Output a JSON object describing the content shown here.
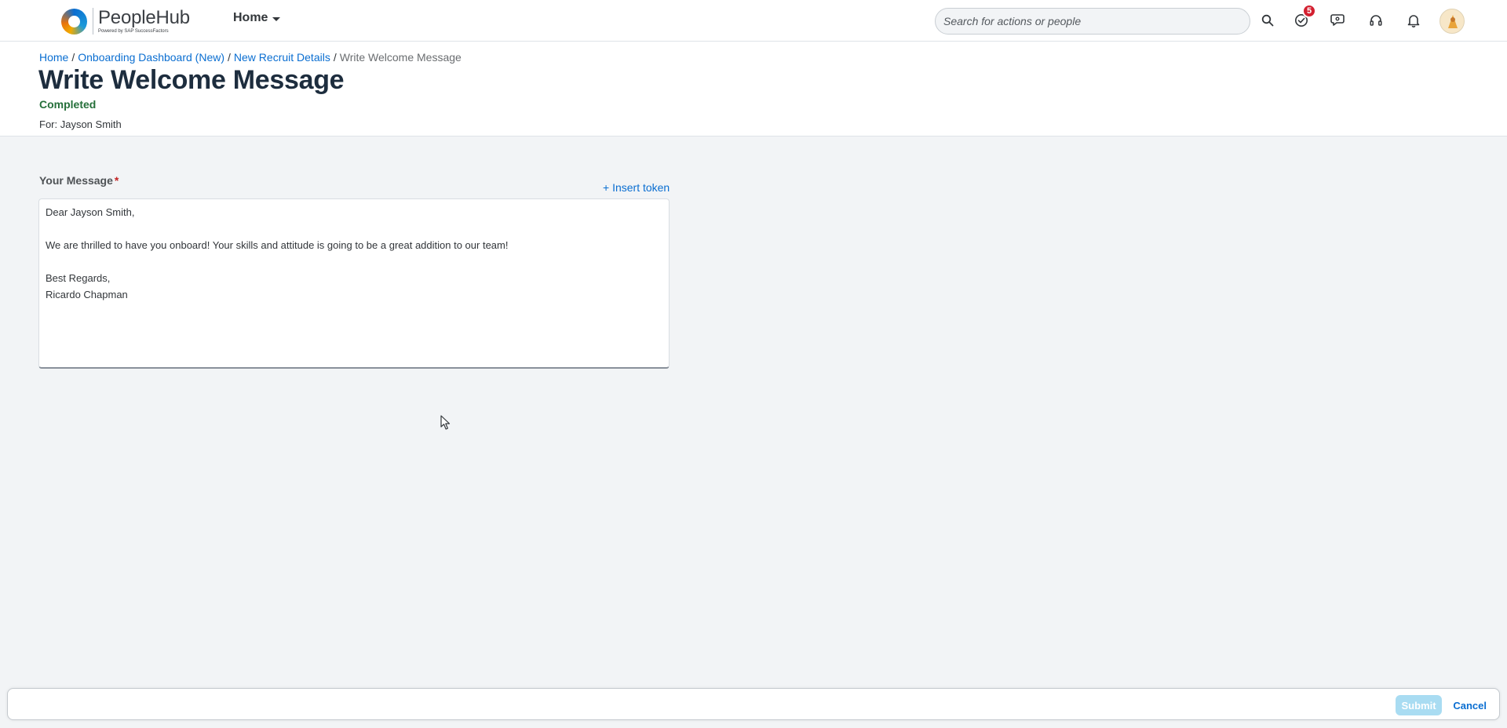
{
  "shell": {
    "logo_name": "PeopleHub",
    "logo_powered": "Powered by SAP SuccessFactors",
    "home_menu_label": "Home",
    "search_placeholder": "Search for actions or people",
    "todo_badge_count": "5",
    "icons": {
      "search": "search-icon",
      "todo": "checkmark-circle-icon",
      "chat": "chat-icon",
      "help": "headset-icon",
      "notifications": "bell-icon"
    }
  },
  "header": {
    "breadcrumb": {
      "items": [
        "Home",
        "Onboarding Dashboard (New)",
        "New Recruit Details"
      ],
      "current": "Write Welcome Message",
      "separator": "/"
    },
    "title": "Write Welcome Message",
    "status": "Completed",
    "status_color": "#256f3a",
    "for_line": "For: Jayson Smith"
  },
  "form": {
    "message_label": "Your Message",
    "required_marker": "*",
    "insert_token_label": "+ Insert token",
    "message_value": "Dear Jayson Smith,\n\nWe are thrilled to have you onboard! Your skills and attitude is going to be a great addition to our team!\n\nBest Regards,\nRicardo Chapman"
  },
  "footer": {
    "submit_label": "Submit",
    "cancel_label": "Cancel"
  },
  "colors": {
    "accent": "#0a6ed1",
    "title": "#1d2d3e",
    "badge": "#d32030",
    "submit_disabled": "#a9dcf2",
    "background": "#f2f4f6"
  }
}
